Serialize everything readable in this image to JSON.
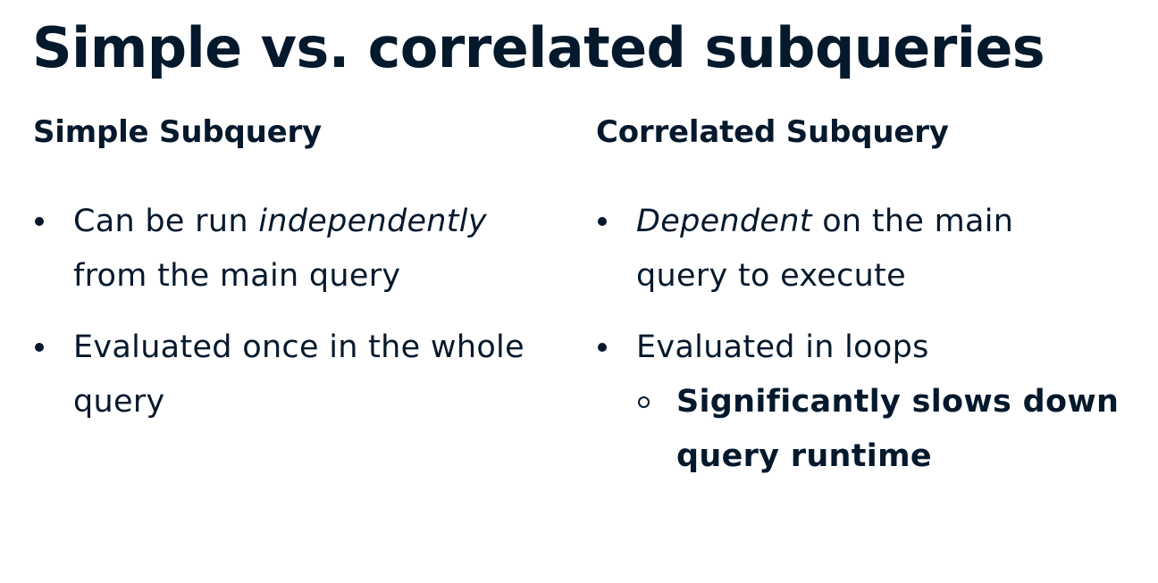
{
  "slide": {
    "title": "Simple vs. correlated subqueries"
  },
  "left": {
    "heading": "Simple Subquery",
    "bullets": [
      {
        "pre": "Can be run ",
        "em": "independently",
        "post": " from the main query"
      },
      {
        "text": "Evaluated once in the whole query"
      }
    ]
  },
  "right": {
    "heading": "Correlated Subquery",
    "bullets": [
      {
        "em": "Dependent",
        "post": " on the main query to execute"
      },
      {
        "text": "Evaluated in loops",
        "sub": "Significantly slows down query runtime"
      }
    ]
  },
  "colors": {
    "text": "#05192d",
    "background": "#ffffff"
  }
}
